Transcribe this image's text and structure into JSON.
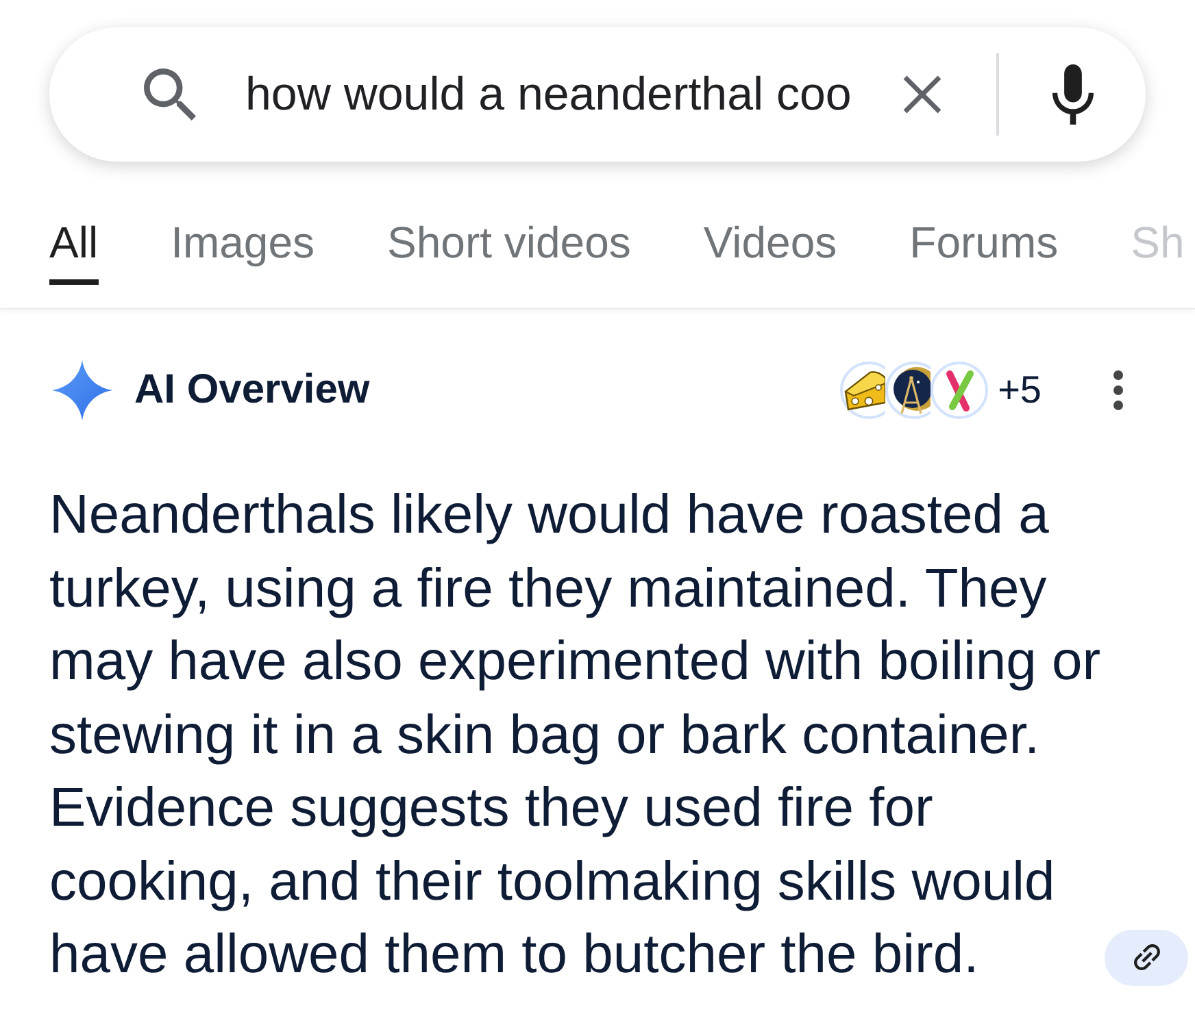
{
  "search": {
    "query": "how would a neanderthal coo"
  },
  "tabs": [
    {
      "label": "All",
      "selected": true
    },
    {
      "label": "Images",
      "selected": false
    },
    {
      "label": "Short videos",
      "selected": false
    },
    {
      "label": "Videos",
      "selected": false
    },
    {
      "label": "Forums",
      "selected": false
    },
    {
      "label": "Sh",
      "selected": false
    }
  ],
  "overview": {
    "title": "AI Overview",
    "source_count": "+5",
    "text": "Neanderthals likely would have roasted a turkey, using a fire they maintained. They may have also experimented with boiling or stewing it in a skin bag or bark container. Evidence suggests they used fire for cooking, and their toolmaking skills would have allowed them to butcher the bird."
  }
}
